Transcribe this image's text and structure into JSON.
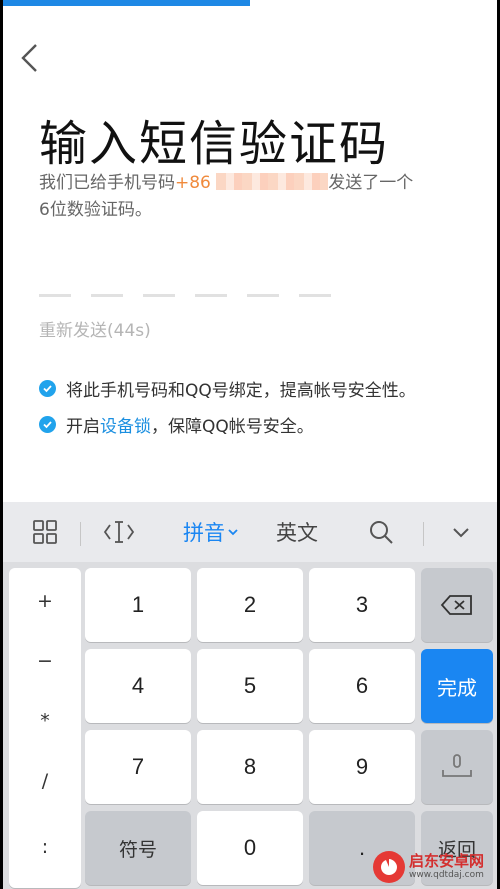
{
  "progress": {
    "fraction": 0.5
  },
  "header": {
    "title": "输入短信验证码"
  },
  "description": {
    "line1_prefix": "我们已给手机号码",
    "country_code": "+86",
    "line1_suffix": "发送了一个",
    "line2": "6位数验证码。"
  },
  "code": {
    "slots": [
      "",
      "",
      "",
      "",
      "",
      ""
    ]
  },
  "resend": {
    "label": "重新发送(44s)"
  },
  "info": {
    "item1": "将此手机号码和QQ号绑定，提高帐号安全性。",
    "item2_prefix": "开启",
    "item2_link": "设备锁",
    "item2_suffix": "，保障QQ帐号安全。"
  },
  "keyboard": {
    "toolbar": {
      "pinyin": "拼音",
      "english": "英文"
    },
    "symbols": [
      "+",
      "−",
      "*",
      "/",
      ":"
    ],
    "keys": {
      "k1": "1",
      "k2": "2",
      "k3": "3",
      "k4": "4",
      "k5": "5",
      "k6": "6",
      "k7": "7",
      "k8": "8",
      "k9": "9",
      "k0": "0",
      "symbol": "符号",
      "done": "完成",
      "dot": ".",
      "back_partial": "返回"
    },
    "accent_color": "#1a86f2"
  },
  "watermark": {
    "cn": "启东安卓网",
    "en": "www.qdtdaj.com"
  }
}
